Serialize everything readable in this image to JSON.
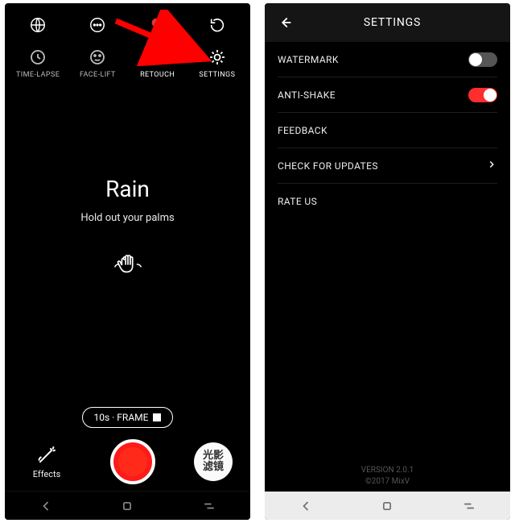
{
  "left": {
    "top_icons": [
      "globe-icon",
      "more-icon",
      "color-filter-icon",
      "rotate-icon"
    ],
    "tools": [
      {
        "label": "TIME-LAPSE"
      },
      {
        "label": "FACE-LIFT"
      },
      {
        "label": "RETOUCH"
      },
      {
        "label": "SETTINGS"
      }
    ],
    "effect_title": "Rain",
    "effect_hint": "Hold out your palms",
    "frame_label": "10s · FRAME",
    "effects_label": "Effects",
    "cn_badge_line1": "光影",
    "cn_badge_line2": "滤镜"
  },
  "right": {
    "header_title": "SETTINGS",
    "rows": {
      "watermark": {
        "label": "WATERMARK",
        "state": "off"
      },
      "antishake": {
        "label": "ANTI-SHAKE",
        "state": "on"
      },
      "feedback": {
        "label": "FEEDBACK"
      },
      "updates": {
        "label": "CHECK FOR UPDATES"
      },
      "rate": {
        "label": "RATE US"
      }
    },
    "version": "VERSION 2.0.1",
    "copyright": "©2017 MixV"
  },
  "arrow_color": "#ff0000"
}
